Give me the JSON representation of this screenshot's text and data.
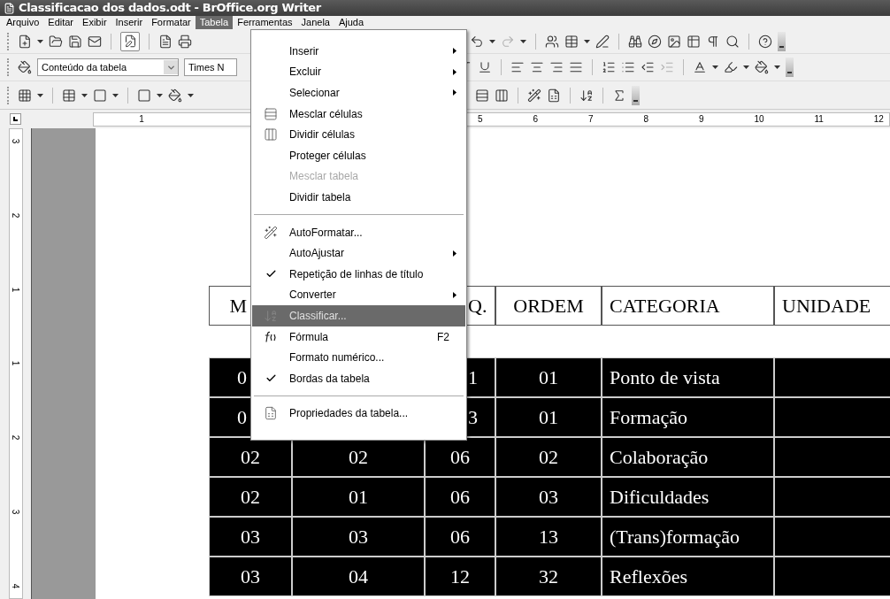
{
  "window": {
    "title": "Classificacao dos dados.odt - BrOffice.org Writer"
  },
  "menu_bar": [
    {
      "label": "Arquivo",
      "selected": false
    },
    {
      "label": "Editar",
      "selected": false
    },
    {
      "label": "Exibir",
      "selected": false
    },
    {
      "label": "Inserir",
      "selected": false
    },
    {
      "label": "Formatar",
      "selected": false
    },
    {
      "label": "Tabela",
      "selected": true
    },
    {
      "label": "Ferramentas",
      "selected": false
    },
    {
      "label": "Janela",
      "selected": false
    },
    {
      "label": "Ajuda",
      "selected": false
    }
  ],
  "toolbar": {
    "edit_mode_pressed": true,
    "paragraph_style": "Conteúdo da tabela",
    "font_name": "Times N"
  },
  "ruler": {
    "left_labels": [
      "1"
    ],
    "right_labels": [
      "5",
      "6",
      "7",
      "8",
      "9",
      "10",
      "11",
      "12"
    ],
    "vertical_labels": [
      "3",
      "2",
      "1",
      "1",
      "2",
      "3",
      "4"
    ]
  },
  "table": {
    "header": {
      "kind": "under-menu",
      "cells": [
        "M",
        "Q.",
        "ORDEM",
        "CATEGORIA",
        "UNIDADE"
      ]
    },
    "rows": [
      {
        "kind": "under-menu",
        "cells": [
          "0",
          "1",
          "01",
          "Ponto de vista"
        ]
      },
      {
        "kind": "under-menu",
        "cells": [
          "0",
          "3",
          "01",
          "Formação"
        ]
      },
      {
        "kind": "full",
        "cells": [
          "02",
          "02",
          "06",
          "02",
          "Colaboração"
        ]
      },
      {
        "kind": "full",
        "cells": [
          "02",
          "01",
          "06",
          "03",
          "Dificuldades"
        ]
      },
      {
        "kind": "full",
        "cells": [
          "03",
          "03",
          "06",
          "13",
          "(Trans)formação"
        ]
      },
      {
        "kind": "full",
        "cells": [
          "03",
          "04",
          "12",
          "32",
          "Reflexões"
        ]
      }
    ]
  },
  "tabela_menu": {
    "items": [
      {
        "kind": "submenu",
        "label": "Inserir",
        "selected": false,
        "checked": false,
        "disabled": false
      },
      {
        "kind": "submenu",
        "label": "Excluir",
        "selected": false,
        "checked": false,
        "disabled": false
      },
      {
        "kind": "submenu",
        "label": "Selecionar",
        "selected": false,
        "checked": false,
        "disabled": false
      },
      {
        "kind": "merge",
        "label": "Mesclar células",
        "selected": false,
        "checked": false,
        "disabled": false
      },
      {
        "kind": "split",
        "label": "Dividir células",
        "selected": false,
        "checked": false,
        "disabled": false
      },
      {
        "kind": "plain",
        "label": "Proteger células",
        "selected": false,
        "checked": false,
        "disabled": false
      },
      {
        "kind": "plain",
        "label": "Mesclar tabela",
        "selected": false,
        "checked": false,
        "disabled": true
      },
      {
        "kind": "plain",
        "label": "Dividir tabela",
        "selected": false,
        "checked": false,
        "disabled": false
      },
      {
        "kind": "separator"
      },
      {
        "kind": "autoformat",
        "label": "AutoFormatar...",
        "selected": false,
        "checked": false,
        "disabled": false
      },
      {
        "kind": "submenu",
        "label": "AutoAjustar",
        "selected": false,
        "checked": false,
        "disabled": false
      },
      {
        "kind": "plain",
        "label": "Repetição de linhas de título",
        "selected": false,
        "checked": true,
        "disabled": false
      },
      {
        "kind": "submenu",
        "label": "Converter",
        "selected": false,
        "checked": false,
        "disabled": false
      },
      {
        "kind": "sort",
        "label": "Classificar...",
        "selected": true,
        "checked": false,
        "disabled": false
      },
      {
        "kind": "formula",
        "label": "Fórmula",
        "shortcut": "F2",
        "selected": false,
        "checked": false,
        "disabled": false
      },
      {
        "kind": "plain",
        "label": "Formato numérico...",
        "selected": false,
        "checked": false,
        "disabled": false
      },
      {
        "kind": "plain",
        "label": "Bordas da tabela",
        "selected": false,
        "checked": true,
        "disabled": false
      },
      {
        "kind": "separator"
      },
      {
        "kind": "properties",
        "label": "Propriedades da tabela...",
        "selected": false,
        "checked": false,
        "disabled": false
      }
    ]
  }
}
